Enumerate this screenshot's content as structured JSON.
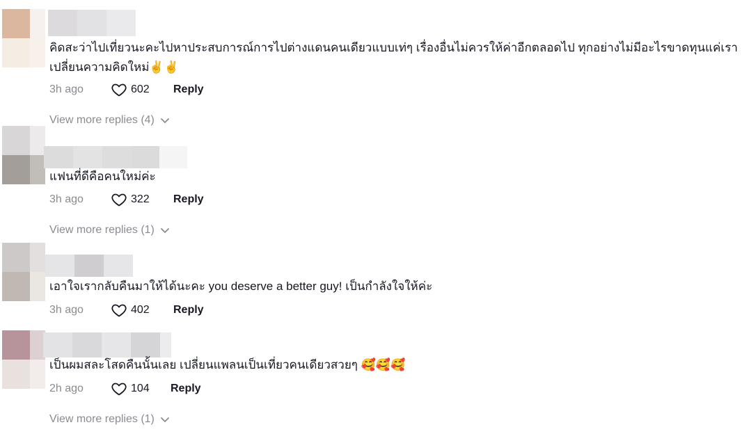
{
  "comments": [
    {
      "text": "คิดสะว่าไปเที่ยวนะคะไปหาประสบการณ์การไปต่างแดนคนเดียวแบบเท่ๆ เรื่องอื่นไม่ควรให้ค่าอีกตลอดไป ทุกอย่างไม่มีอะไรขาดทุนแค่เราเปลี่ยนความคิดใหม่✌️✌️",
      "time": "3h ago",
      "likes": "602",
      "reply_label": "Reply",
      "more_replies": "View more replies (4)",
      "avatar_colors": [
        "#dcb79f",
        "#f6f1ee",
        "#f5ece4",
        "#f8f0ea"
      ],
      "name_blur_colors": [
        "#dcdadd",
        "#e2e1e3",
        "#eae9eb"
      ]
    },
    {
      "text": "แฟนที่ดีคือคนใหม่ค่ะ",
      "time": "3h ago",
      "likes": "322",
      "reply_label": "Reply",
      "more_replies": "View more replies (1)",
      "avatar_colors": [
        "#d8d6d6",
        "#eceaea",
        "#a39e9a",
        "#c1bdb9"
      ],
      "name_blur_colors": [
        "#dddcdc",
        "#e4e3e3",
        "#dedddd",
        "#f5f5f5"
      ]
    },
    {
      "text": "เอาใจเรากลับคืนมาให้ได้นะคะ you deserve a better guy! เป็นกำลังใจให้ค่ะ",
      "time": "3h ago",
      "likes": "402",
      "reply_label": "Reply",
      "more_replies": "",
      "avatar_colors": [
        "#cdc9c8",
        "#e3dfde",
        "#c0b8b2",
        "#eae6e2"
      ],
      "name_blur_colors": [
        "#e5e4e6",
        "#cfcdcf",
        "#e6e5e7"
      ]
    },
    {
      "text": "เป็นผมสละโสดคืนนั้นเลย เปลี่ยนแพลนเป็นเที่ยวคนเดียวสวยๆ 🥰🥰🥰",
      "time": "2h ago",
      "likes": "104",
      "reply_label": "Reply",
      "more_replies": "View more replies (1)",
      "avatar_colors": [
        "#b7949b",
        "#ddd0d3",
        "#e9e1de",
        "#f2ecea"
      ],
      "name_blur_colors": [
        "#e3e2e4",
        "#d9d8da",
        "#e6e5e7",
        "#d5d4d6"
      ]
    }
  ]
}
